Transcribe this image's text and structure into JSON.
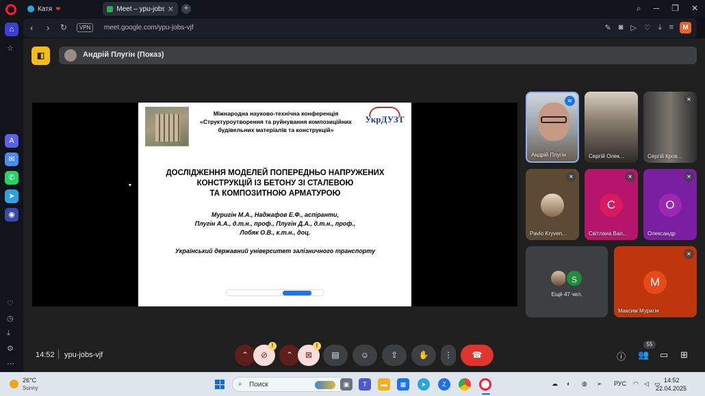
{
  "browser": {
    "tabs": [
      {
        "label": "Катя",
        "icon": "telegram-icon",
        "heart": "❤"
      },
      {
        "label": "Meet – ypu-jobs-",
        "icon": "meet-icon"
      }
    ],
    "address": {
      "vpn": "VPN",
      "url": "meet.google.com/ypu-jobs-vjf"
    },
    "profile_initial": "M",
    "colors": {
      "opera_red": "#ff1b2d",
      "accent": "#3d3fd1"
    }
  },
  "meet": {
    "presenter": "Андрій Плугін (Показ)",
    "time": "14:52",
    "code": "ypu-jobs-vjf",
    "participants_count": "55",
    "slide": {
      "conference": "Міжнародна науково-технічна конференція «Структуроутворення та руйнування композиційних будівельних матеріалів та конструкцій»",
      "logo": "УкрДУЗТ",
      "title_lines": [
        "ДОСЛІДЖЕННЯ МОДЕЛЕЙ ПОПЕРЕДНЬО НАПРУЖЕНИХ",
        "КОНСТРУКЦІЙ ІЗ БЕТОНУ ЗІ СТАЛЕВОЮ",
        "ТА КОМПОЗИТНОЮ АРМАТУРОЮ"
      ],
      "author_lines": [
        "Муригін М.А., Наджафов Е.Ф., аспіранти,",
        "Плугін А.А., д.т.н., проф., Плугін Д.А., д.т.н., проф.,",
        "Лобяк О.В., к.т.н., доц."
      ],
      "university": "Український державний університет залізничного транспорту"
    },
    "tiles": [
      {
        "name": "Андрій Плугін"
      },
      {
        "name": "Сергій Олек..."
      },
      {
        "name": "Сергій Кров..."
      },
      {
        "name": "Pavlo Kryven..."
      },
      {
        "name": "Світлана Вал...",
        "letter": "С",
        "color": "#b5166b"
      },
      {
        "name": "Олександр",
        "letter": "О",
        "color": "#7b1fa2"
      },
      {
        "name": "Ещё 47 чел.",
        "letter": "S"
      },
      {
        "name": "Максим Муригін",
        "letter": "М",
        "color": "#bf360c"
      }
    ],
    "controls": {
      "end_call_color": "#dc362e",
      "warn": "!"
    }
  },
  "taskbar": {
    "weather_temp": "26°C",
    "weather_desc": "Sunny",
    "search_placeholder": "Поиск",
    "lang": "РУС",
    "clock_time": "14:52",
    "clock_date": "22.04.2025"
  }
}
